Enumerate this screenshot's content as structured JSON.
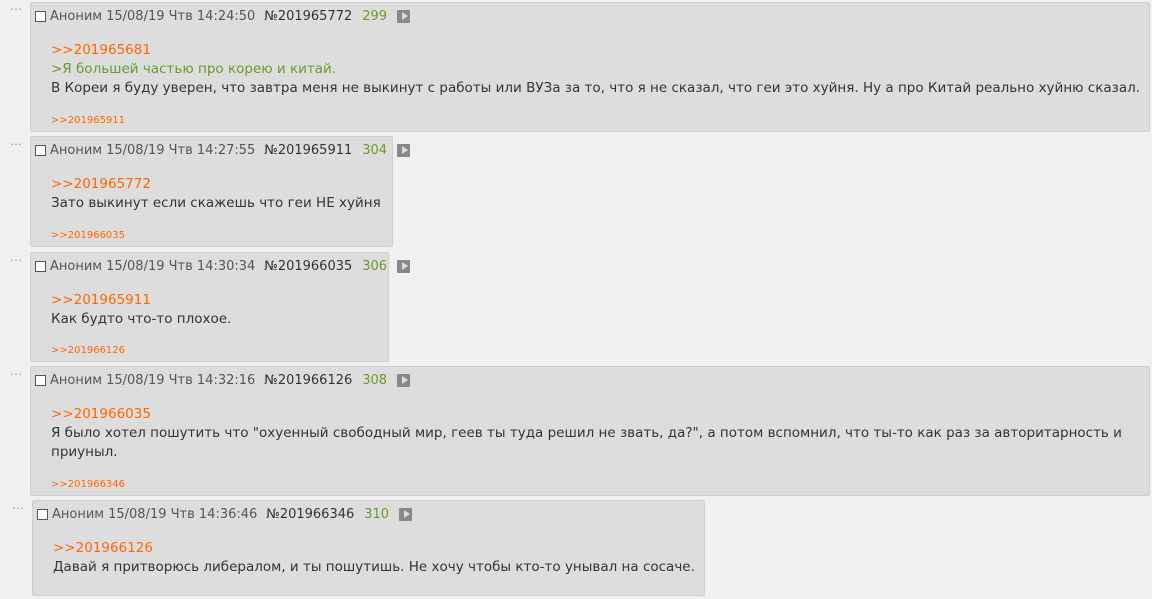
{
  "posts": [
    {
      "author": "Аноним",
      "date": "15/08/19 Чтв 14:24:50",
      "number": "№201965772",
      "index": "299",
      "reply_to": ">>201965681",
      "quote": ">Я большей частью про корею и китай.",
      "text_lines": [
        "В Кореи я буду уверен, что завтра меня не выкинут с работы или ВУЗа за то, что я не сказал, что геи это хуйня. Ну а про Китай реально хуйню сказал."
      ],
      "replies": ">>201965911"
    },
    {
      "author": "Аноним",
      "date": "15/08/19 Чтв 14:27:55",
      "number": "№201965911",
      "index": "304",
      "reply_to": ">>201965772",
      "text_lines": [
        "Зато выкинут если скажешь что геи НЕ хуйня"
      ],
      "replies": ">>201966035"
    },
    {
      "author": "Аноним",
      "date": "15/08/19 Чтв 14:30:34",
      "number": "№201966035",
      "index": "306",
      "reply_to": ">>201965911",
      "text_lines": [
        "Как будто что-то плохое."
      ],
      "replies": ">>201966126"
    },
    {
      "author": "Аноним",
      "date": "15/08/19 Чтв 14:32:16",
      "number": "№201966126",
      "index": "308",
      "reply_to": ">>201966035",
      "text_lines": [
        "Я было хотел пошутить что \"охуенный свободный мир, геев ты туда решил не звать, да?\", а потом вспомнил, что ты-то как раз за авторитарность и",
        "приуныл."
      ],
      "replies": ">>201966346"
    },
    {
      "author": "Аноним",
      "date": "15/08/19 Чтв 14:36:46",
      "number": "№201966346",
      "index": "310",
      "reply_to": ">>201966126",
      "text_lines": [
        "Давай я притворюсь либералом, и ты пошутишь. Не хочу чтобы кто-то унывал на сосаче."
      ]
    }
  ],
  "icons": {
    "checkbox": "checkbox-icon",
    "play": "play-icon",
    "dots": "ellipsis-icon"
  },
  "colors": {
    "reply_link": "#ff6600",
    "quote": "#6a9a28",
    "post_bg": "#dddddd",
    "page_bg": "#f0f0f0"
  }
}
